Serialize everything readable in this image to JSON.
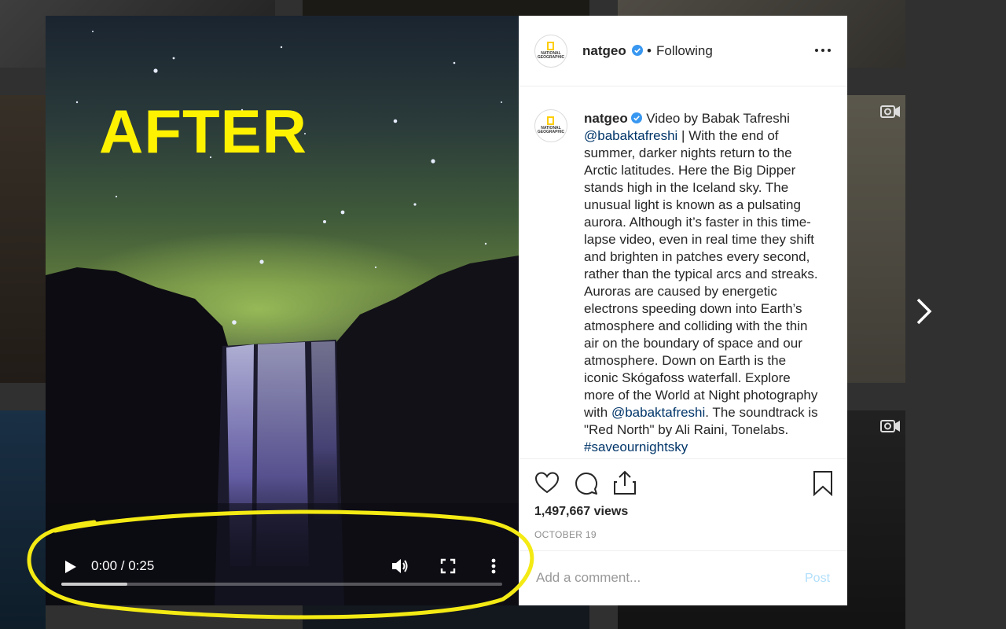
{
  "video": {
    "overlay_text": "AFTER",
    "time": "0:00 / 0:25",
    "progress_fraction": 0.0,
    "buffered_fraction": 0.15
  },
  "header": {
    "username": "natgeo",
    "separator": "•",
    "follow_status": "Following",
    "avatar_text": "NATIONAL GEOGRAPHIC"
  },
  "caption": {
    "username": "natgeo",
    "lead": "Video by Babak Tafreshi",
    "mention1": "@babaktafreshi",
    "body": " | With the end of summer, darker nights return to the Arctic latitudes. Here the Big Dipper stands high in the Iceland sky. The unusual light is known as a pulsating aurora. Although it’s faster in this time-lapse video, even in real time they shift and brighten in patches every second, rather than the typical arcs and streaks. Auroras are caused by energetic electrons speeding down into Earth’s atmosphere and colliding with the thin air on the boundary of space and our atmosphere. Down on Earth is the iconic Skógafoss waterfall. Explore more of the World at Night photography with ",
    "mention2": "@babaktafreshi",
    "tail": ". The soundtrack is \"Red North\" by Ali Raini, Tonelabs. ",
    "hashtag": "#saveournightsky"
  },
  "stats": {
    "views": "1,497,667 views",
    "date": "OCTOBER 19"
  },
  "comment": {
    "placeholder": "Add a comment...",
    "post_label": "Post"
  },
  "colors": {
    "highlight_yellow": "#fff200",
    "link_blue": "#003569",
    "verified_blue": "#3897f0",
    "post_disabled": "#b2dffc"
  }
}
